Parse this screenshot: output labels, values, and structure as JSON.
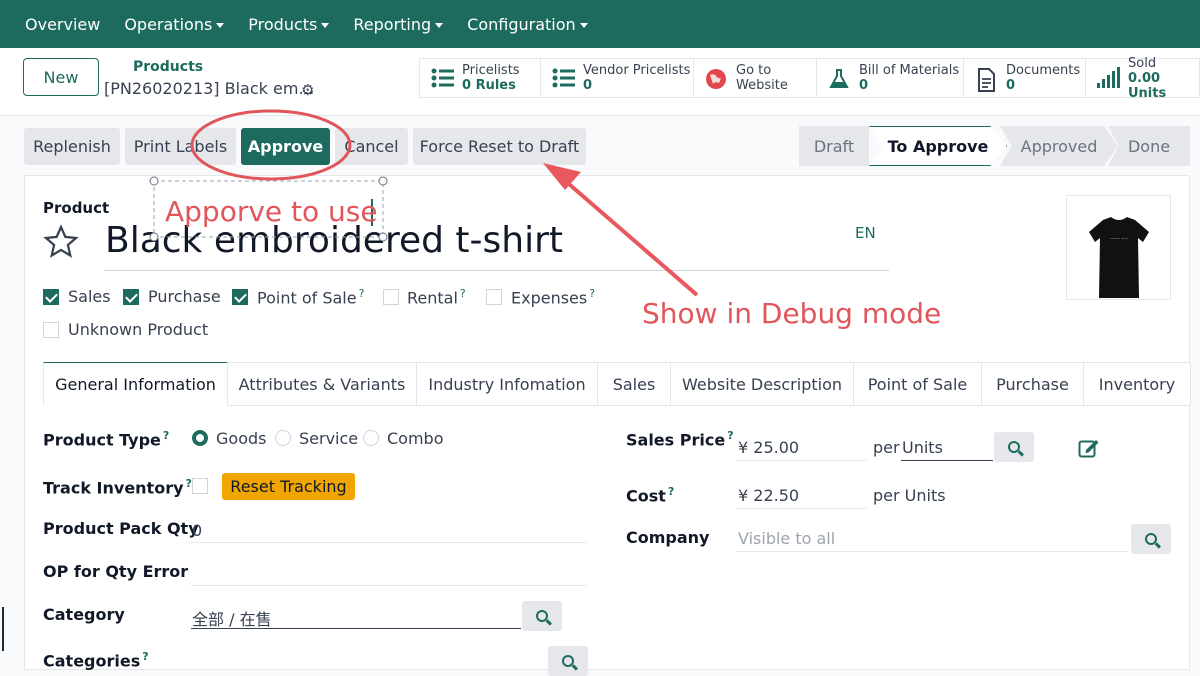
{
  "nav": {
    "items": [
      {
        "label": "Overview",
        "caret": false
      },
      {
        "label": "Operations",
        "caret": true
      },
      {
        "label": "Products",
        "caret": true
      },
      {
        "label": "Reporting",
        "caret": true
      },
      {
        "label": "Configuration",
        "caret": true
      }
    ]
  },
  "control": {
    "new_label": "New",
    "breadcrumb_parent": "Products",
    "breadcrumb_current": "[PN26020213] Black em…",
    "smart_buttons": [
      {
        "icon": "list-icon",
        "line1": "Pricelists",
        "line2": "0 Rules"
      },
      {
        "icon": "list-icon",
        "line1": "Vendor Pricelists",
        "line2": "0"
      },
      {
        "icon": "globe-icon",
        "line1": "Go to",
        "line2": "Website"
      },
      {
        "icon": "flask-icon",
        "line1": "Bill of Materials",
        "line2": "0"
      },
      {
        "icon": "document-icon",
        "line1": "Documents",
        "line2": "0"
      },
      {
        "icon": "signal-bars-icon",
        "line1": "Sold",
        "line2": "0.00 Units"
      }
    ]
  },
  "actions": {
    "replenish": "Replenish",
    "print_labels": "Print Labels",
    "approve": "Approve",
    "cancel": "Cancel",
    "force_reset": "Force Reset to Draft"
  },
  "stages": [
    "Draft",
    "To Approve",
    "Approved",
    "Done"
  ],
  "stage_active": "To Approve",
  "product": {
    "label": "Product",
    "name": "Black embroidered t-shirt",
    "lang": "EN",
    "checks": [
      {
        "label": "Sales",
        "checked": true,
        "help": false
      },
      {
        "label": "Purchase",
        "checked": true,
        "help": false
      },
      {
        "label": "Point of Sale",
        "checked": true,
        "help": true
      },
      {
        "label": "Rental",
        "checked": false,
        "help": true
      },
      {
        "label": "Expenses",
        "checked": false,
        "help": true
      },
      {
        "label": "Unknown Product",
        "checked": false,
        "help": false
      }
    ]
  },
  "tabs": [
    "General Information",
    "Attributes & Variants",
    "Industry Infomation",
    "Sales",
    "Website Description",
    "Point of Sale",
    "Purchase",
    "Inventory"
  ],
  "general": {
    "product_type_label": "Product Type",
    "type_options": [
      "Goods",
      "Service",
      "Combo"
    ],
    "type_selected": "Goods",
    "track_inventory_label": "Track Inventory",
    "reset_tracking": "Reset Tracking",
    "pack_qty_label": "Product Pack Qty",
    "pack_qty_value": "0",
    "op_error_label": "OP for Qty Error",
    "category_label": "Category",
    "category_value": "全部 / 在售",
    "categories_label": "Categories",
    "sales_price_label": "Sales Price",
    "sales_price_value": "¥ 25.00",
    "per_label": "per",
    "sales_uom": "Units",
    "cost_label": "Cost",
    "cost_value": "¥ 22.50",
    "cost_uom": "per Units",
    "company_label": "Company",
    "company_placeholder": "Visible to all"
  },
  "annotations": {
    "approve_note": "Apporve to use",
    "debug_note": "Show in Debug mode"
  },
  "colors": {
    "brand": "#1d6b5e",
    "annotation": "#e0565b",
    "warning": "#f0a500"
  }
}
